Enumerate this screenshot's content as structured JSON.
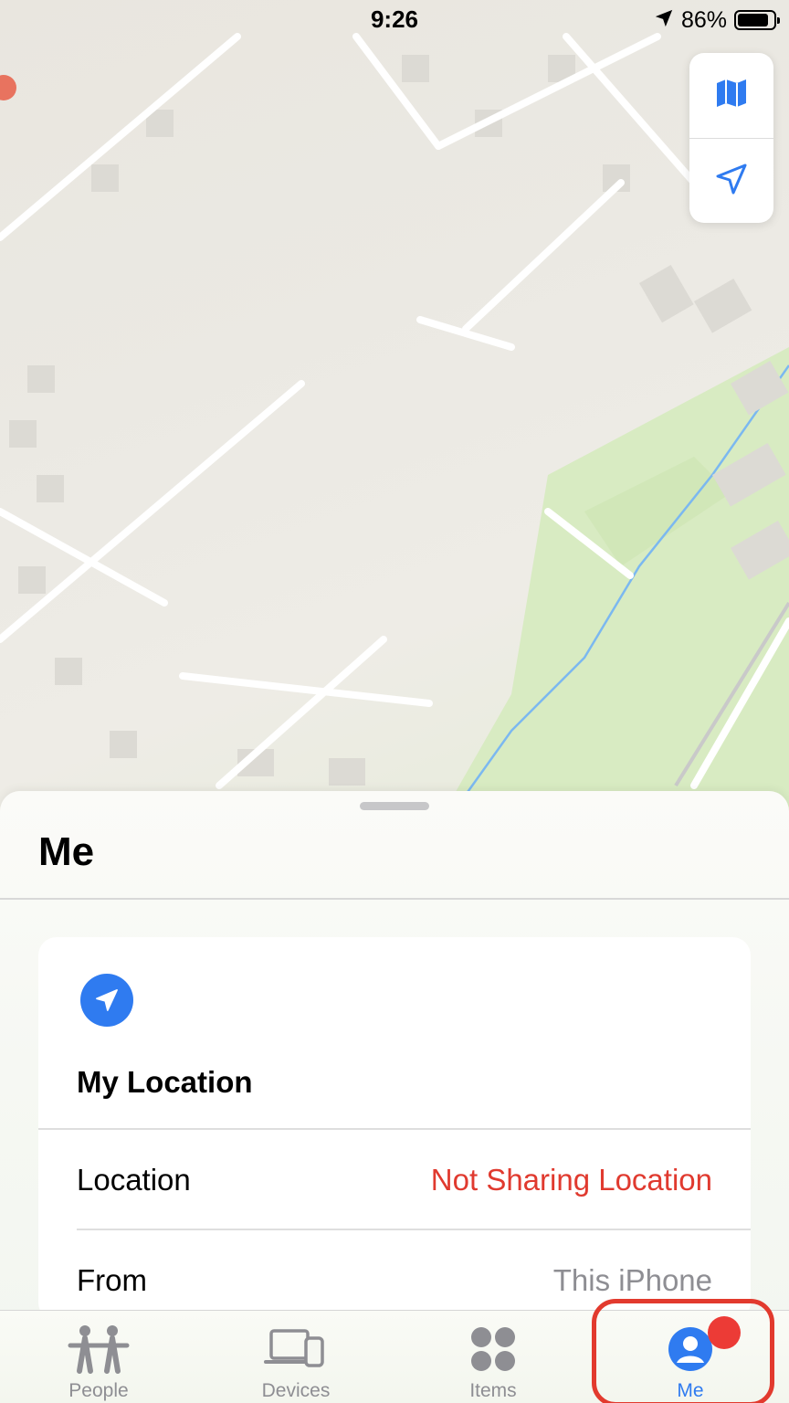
{
  "status_bar": {
    "time": "9:26",
    "battery_percent": "86%",
    "battery_level": 0.86,
    "location_arrow_icon": "location-arrow-icon"
  },
  "map": {
    "controls": [
      {
        "name": "map-mode",
        "icon": "map-icon"
      },
      {
        "name": "locate",
        "icon": "navigation-arrow-icon"
      }
    ],
    "colors": {
      "land": "#ebe9e3",
      "park": "#d8ebc2",
      "water": "#7bb8f0",
      "building": "#dcdad4"
    }
  },
  "sheet": {
    "title": "Me",
    "card": {
      "icon": "location-arrow-icon",
      "heading": "My Location",
      "rows": [
        {
          "label": "Location",
          "value": "Not Sharing Location",
          "value_color": "#e03a2f"
        },
        {
          "label": "From",
          "value": "This iPhone",
          "value_color": "#8e8e93"
        }
      ]
    }
  },
  "tab_bar": {
    "tabs": [
      {
        "label": "People",
        "icon": "people-icon",
        "active": false
      },
      {
        "label": "Devices",
        "icon": "devices-icon",
        "active": false
      },
      {
        "label": "Items",
        "icon": "items-grid-icon",
        "active": false
      },
      {
        "label": "Me",
        "icon": "person-circle-icon",
        "active": true,
        "badge": true
      }
    ],
    "accent_color": "#2f7bf0",
    "badge_color": "#ec3b36",
    "highlight_color": "#e23a2e"
  }
}
